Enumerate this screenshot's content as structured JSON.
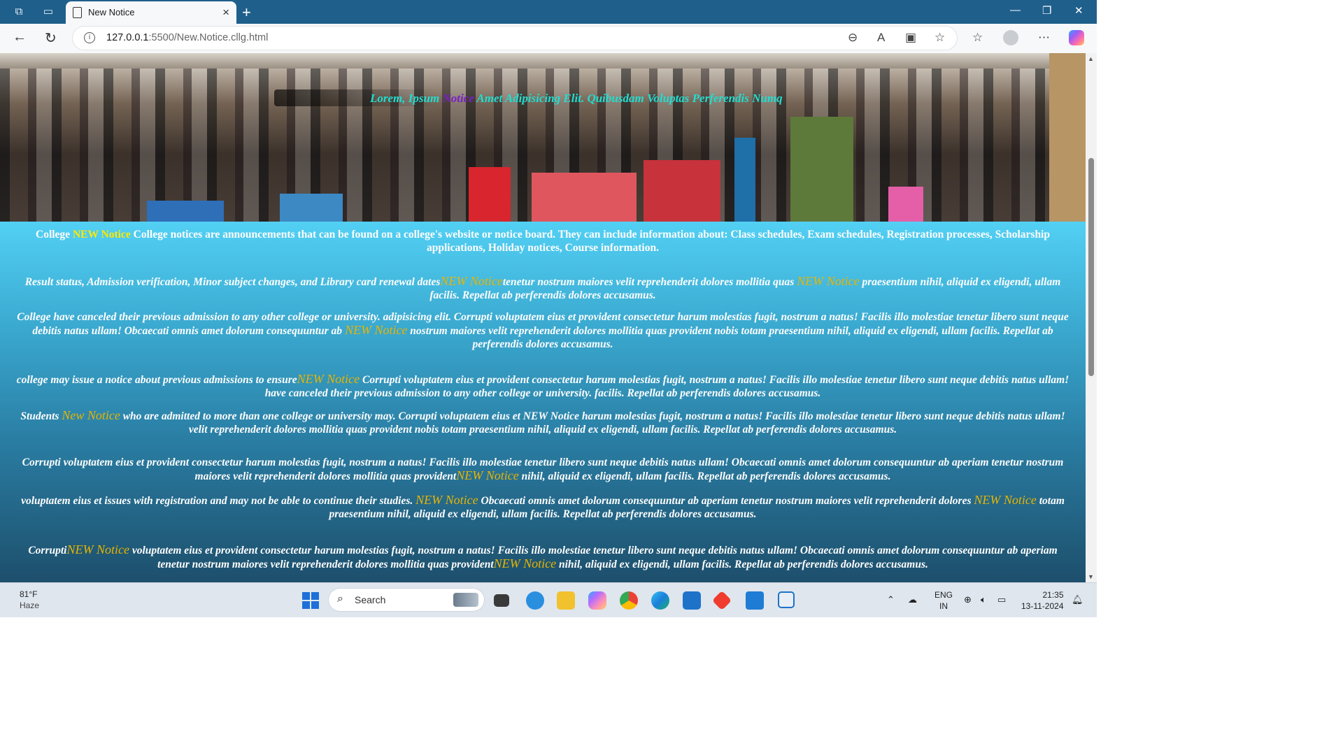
{
  "browser": {
    "tab_title": "New Notice",
    "url_host": "127.0.0.1",
    "url_rest": ":5500/New.Notice.cllg.html"
  },
  "hero": {
    "pre": "Lorem, Ipsum ",
    "notice": "Notice",
    "post": " Amet Adipisicing Elit. Quibusdam Voluptas Perferendis Numq"
  },
  "intro": {
    "college": "College ",
    "notice": "NEW Notice",
    "text": " College notices are announcements that can be found on a college's website or notice board. They can include information about: Class schedules, Exam schedules, Registration processes, Scholarship applications, Holiday notices, Course information."
  },
  "p1": {
    "a": "Result status, Admission verification, Minor subject changes, and Library card renewal dates",
    "n1": "NEW Notice",
    "b": "tenetur nostrum maiores velit reprehenderit dolores mollitia quas ",
    "n2": "NEW Notice",
    "c": " praesentium nihil, aliquid ex eligendi, ullam facilis. Repellat ab perferendis dolores accusamus."
  },
  "p2": {
    "a": "College have canceled their previous admission to any other college or university. adipisicing elit. Corrupti voluptatem eius et provident consectetur harum molestias fugit, nostrum a natus! Facilis illo molestiae tenetur libero sunt neque debitis natus ullam! Obcaecati omnis amet dolorum consequuntur ab ",
    "n1": "NEW Notice",
    "b": " nostrum maiores velit reprehenderit dolores mollitia quas provident nobis totam praesentium nihil, aliquid ex eligendi, ullam facilis. Repellat ab perferendis dolores accusamus."
  },
  "p3": {
    "a": "college may issue a notice about previous admissions to ensure",
    "n1": "NEW Notice",
    "b": " Corrupti voluptatem eius et provident consectetur harum molestias fugit, nostrum a natus! Facilis illo molestiae tenetur libero sunt neque debitis natus ullam! have canceled their previous admission to any other college or university. facilis. Repellat ab perferendis dolores accusamus."
  },
  "p4": {
    "a": "Students ",
    "n1": "New Notice",
    "b": " who are admitted to more than one college or university may. Corrupti voluptatem eius et NEW Notice harum molestias fugit, nostrum a natus! Facilis illo molestiae tenetur libero sunt neque debitis natus ullam! velit reprehenderit dolores mollitia quas provident nobis totam praesentium nihil, aliquid ex eligendi, ullam facilis. Repellat ab perferendis dolores accusamus."
  },
  "p5": {
    "a": "Corrupti voluptatem eius et provident consectetur harum molestias fugit, nostrum a natus! Facilis illo molestiae tenetur libero sunt neque debitis natus ullam! Obcaecati omnis amet dolorum consequuntur ab aperiam tenetur nostrum maiores velit reprehenderit dolores mollitia quas provident",
    "n1": "NEW Notice",
    "b": " nihil, aliquid ex eligendi, ullam facilis. Repellat ab perferendis dolores accusamus."
  },
  "p6": {
    "a": "voluptatem eius et issues with registration  and may not be able to continue their studies. ",
    "n1": "NEW Notice",
    "b": " Obcaecati omnis amet dolorum consequuntur ab aperiam tenetur nostrum maiores velit reprehenderit dolores ",
    "n2": "NEW Notice",
    "c": " totam praesentium nihil, aliquid ex eligendi, ullam facilis. Repellat ab perferendis dolores accusamus."
  },
  "p7": {
    "a": "Corrupti",
    "n1": "NEW Notice",
    "b": " voluptatem eius et provident consectetur harum molestias fugit, nostrum a natus! Facilis illo molestiae tenetur libero sunt neque debitis natus ullam! Obcaecati omnis amet dolorum consequuntur ab aperiam tenetur nostrum maiores velit reprehenderit dolores mollitia quas provident",
    "n2": "NEW Notice",
    "c": " nihil, aliquid ex eligendi, ullam facilis. Repellat ab perferendis dolores accusamus."
  },
  "taskbar": {
    "temp": "81°F",
    "weather": "Haze",
    "search": "Search",
    "lang1": "ENG",
    "lang2": "IN",
    "time": "21:35",
    "date": "13-11-2024"
  }
}
